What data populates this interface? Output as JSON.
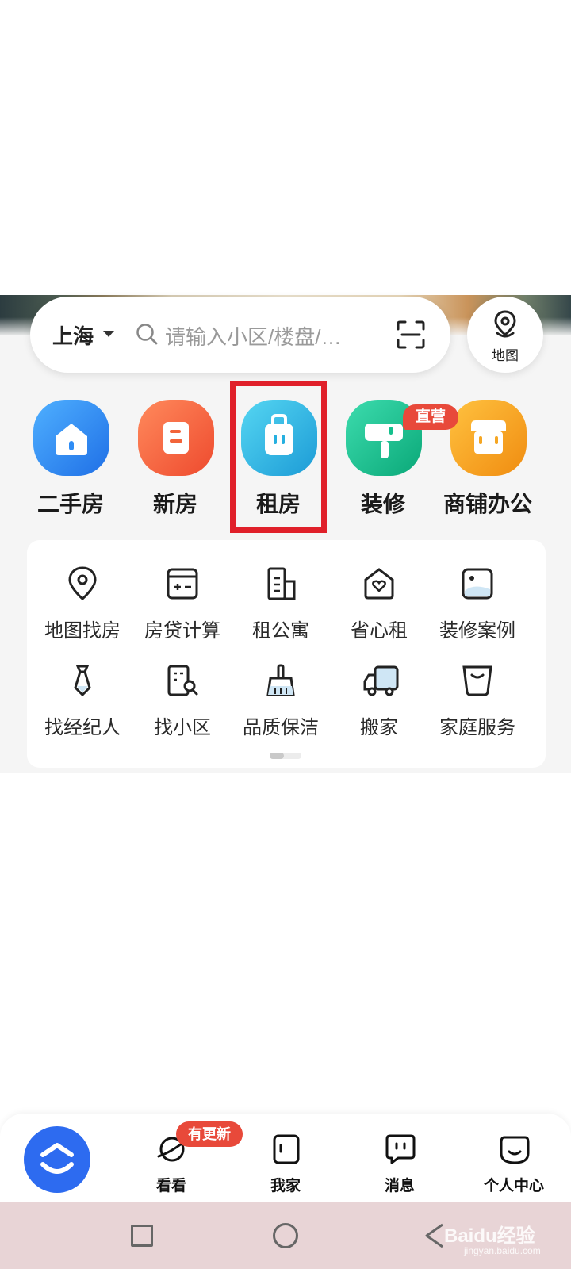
{
  "search": {
    "city": "上海",
    "placeholder": "请输入小区/楼盘/…"
  },
  "map_button": {
    "label": "地图"
  },
  "categories": [
    {
      "label": "二手房",
      "icon": "house-icon",
      "color": "#2f8df5"
    },
    {
      "label": "新房",
      "icon": "new-house-icon",
      "color": "#f2643a"
    },
    {
      "label": "租房",
      "icon": "rent-bag-icon",
      "color": "#26b0e0"
    },
    {
      "label": "装修",
      "icon": "paint-roller-icon",
      "color": "#14c08c",
      "badge": "直营"
    },
    {
      "label": "商铺办公",
      "icon": "shop-icon",
      "color": "#f5a623"
    }
  ],
  "highlighted_category": "租房",
  "services": [
    {
      "label": "地图找房",
      "icon": "map-pin-icon"
    },
    {
      "label": "房贷计算",
      "icon": "calculator-icon"
    },
    {
      "label": "租公寓",
      "icon": "apartment-icon"
    },
    {
      "label": "省心租",
      "icon": "heart-house-icon"
    },
    {
      "label": "装修案例",
      "icon": "gallery-icon"
    },
    {
      "label": "找经纪人",
      "icon": "tie-icon"
    },
    {
      "label": "找小区",
      "icon": "building-search-icon"
    },
    {
      "label": "品质保洁",
      "icon": "broom-icon"
    },
    {
      "label": "搬家",
      "icon": "truck-icon"
    },
    {
      "label": "家庭服务",
      "icon": "basket-icon"
    }
  ],
  "tabbar": {
    "home_icon": "beike-logo-icon",
    "tabs": [
      {
        "label": "看看",
        "icon": "planet-icon",
        "badge": "有更新"
      },
      {
        "label": "我家",
        "icon": "door-icon"
      },
      {
        "label": "消息",
        "icon": "chat-icon"
      },
      {
        "label": "个人中心",
        "icon": "smile-icon"
      }
    ]
  },
  "system_nav": {
    "watermark": "Baidu经验",
    "watermark_sub": "jingyan.baidu.com"
  }
}
